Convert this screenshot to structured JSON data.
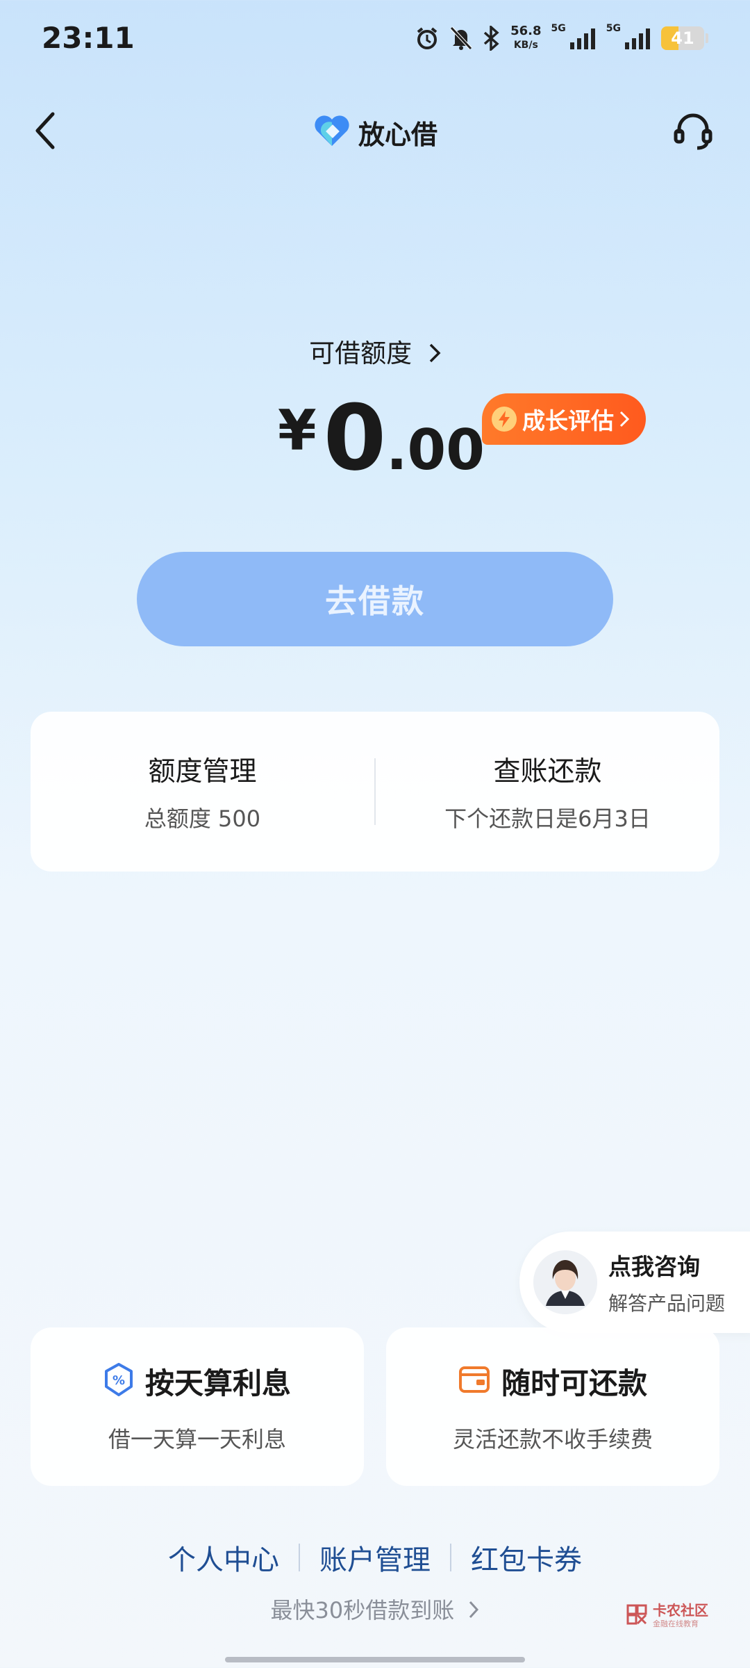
{
  "status_bar": {
    "time": "23:11",
    "net_speed_value": "56.8",
    "net_speed_unit": "KB/s",
    "sim1_label": "5G",
    "sim2_label": "5G",
    "battery_level": "41",
    "icons": [
      "alarm-icon",
      "mute-bell-icon",
      "bluetooth-icon",
      "signal-icon",
      "signal-icon",
      "battery-icon"
    ]
  },
  "nav": {
    "back_icon": "chevron-left-icon",
    "brand_name": "放心借",
    "support_icon": "headset-icon"
  },
  "limit": {
    "label": "可借额度",
    "currency_symbol": "¥",
    "amount_int": "0",
    "amount_dec": ".00",
    "growth_button": "成长评估"
  },
  "borrow_button": "去借款",
  "manage": {
    "quota": {
      "title": "额度管理",
      "sub": "总额度 500"
    },
    "repay": {
      "title": "查账还款",
      "sub": "下个还款日是6月3日"
    }
  },
  "consult": {
    "title": "点我咨询",
    "sub": "解答产品问题"
  },
  "features": [
    {
      "title": "按天算利息",
      "sub": "借一天算一天利息",
      "icon": "percent-shield-icon"
    },
    {
      "title": "随时可还款",
      "sub": "灵活还款不收手续费",
      "icon": "wallet-icon"
    }
  ],
  "bottom_links": [
    "个人中心",
    "账户管理",
    "红包卡券"
  ],
  "promo": "最快30秒借款到账",
  "watermark": {
    "title": "卡农社区",
    "sub": "金融在线教育"
  },
  "colors": {
    "accent": "#ff6a24",
    "primary_button": "#8fbaf7",
    "link": "#1f4e93"
  }
}
